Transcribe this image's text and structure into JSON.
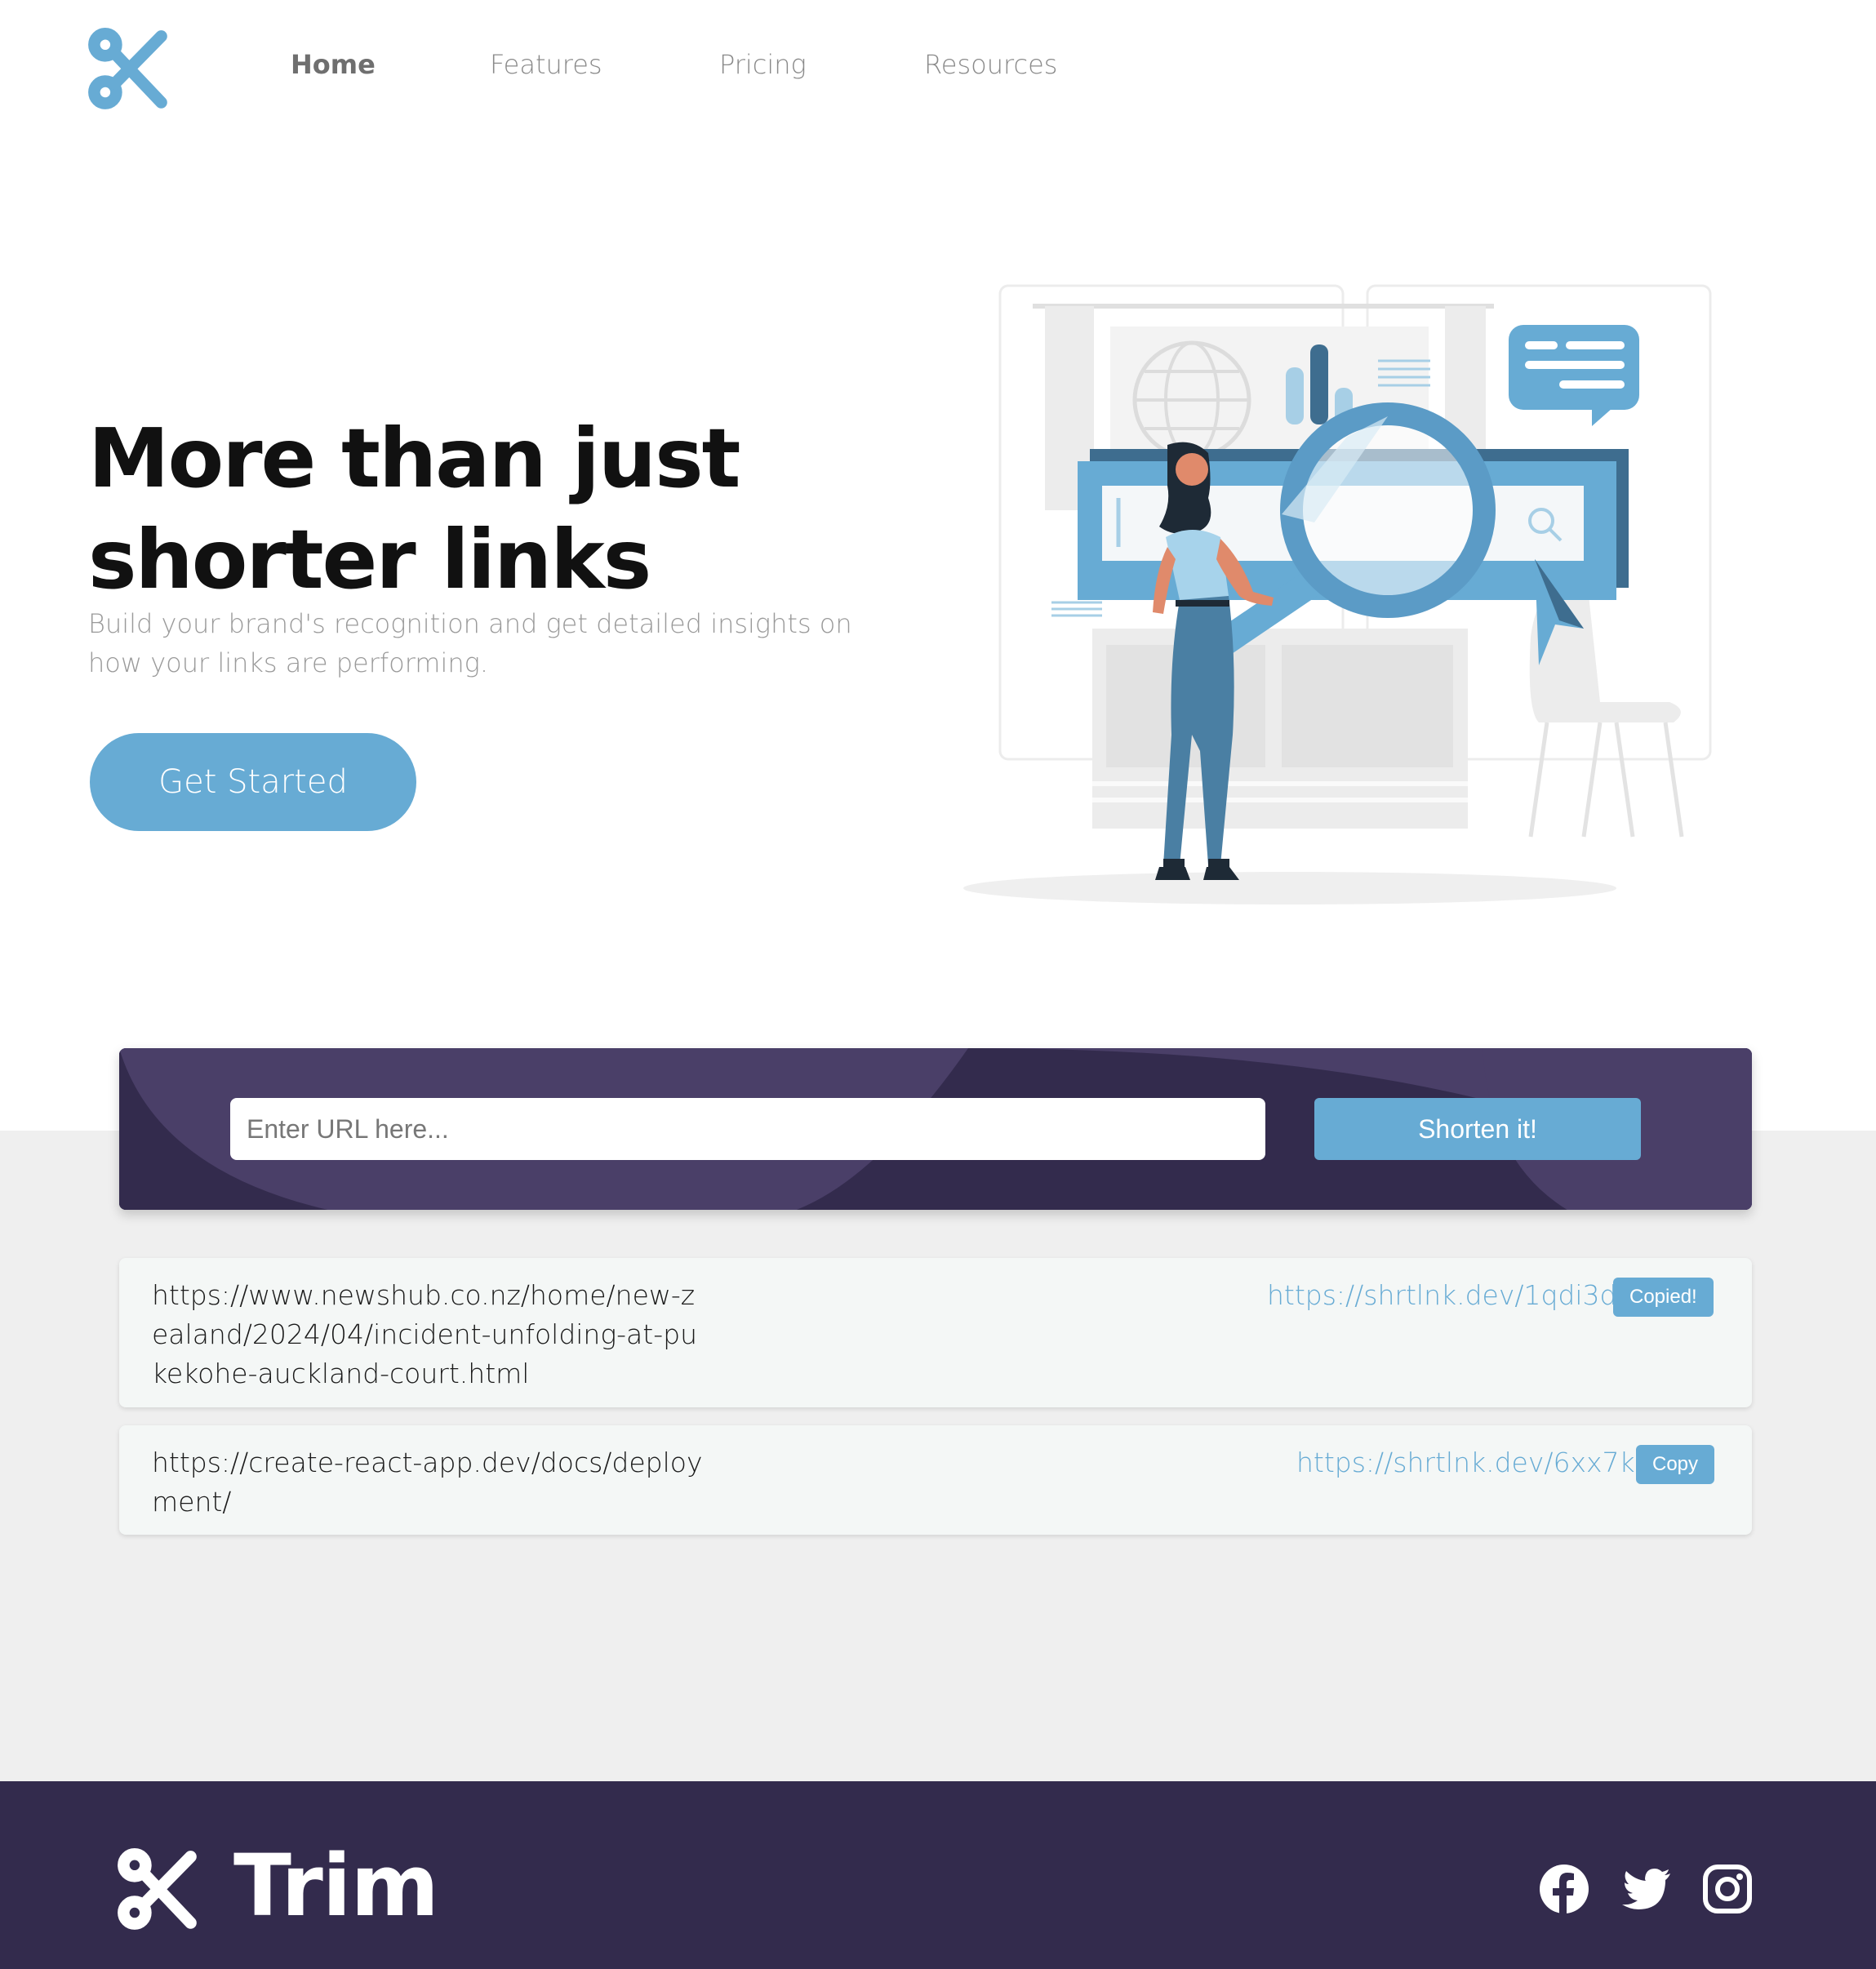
{
  "nav": {
    "items": [
      {
        "label": "Home",
        "active": true
      },
      {
        "label": "Features",
        "active": false
      },
      {
        "label": "Pricing",
        "active": false
      },
      {
        "label": "Resources",
        "active": false
      }
    ]
  },
  "hero": {
    "title_line1": "More than just",
    "title_line2": "shorter links",
    "subtitle": "Build your brand's recognition and get detailed insights on how your links are performing.",
    "cta_label": "Get Started"
  },
  "shortener": {
    "placeholder": "Enter URL here...",
    "button_label": "Shorten it!"
  },
  "results": [
    {
      "original": "https://www.newshub.co.nz/home/new-zealand/2024/04/incident-unfolding-at-pukekohe-auckland-court.html",
      "short": "https://shrtlnk.dev/1qdi3d",
      "button_label": "Copied!"
    },
    {
      "original": "https://create-react-app.dev/docs/deployment/",
      "short": "https://shrtlnk.dev/6xx7kx",
      "button_label": "Copy"
    }
  ],
  "footer": {
    "brand": "Trim",
    "social_icons": [
      "facebook-icon",
      "twitter-icon",
      "instagram-icon"
    ]
  },
  "colors": {
    "accent": "#67abd4",
    "dark_purple": "#332b4d",
    "panel_purple": "#4a3f68",
    "grey_bg": "#efefef"
  }
}
